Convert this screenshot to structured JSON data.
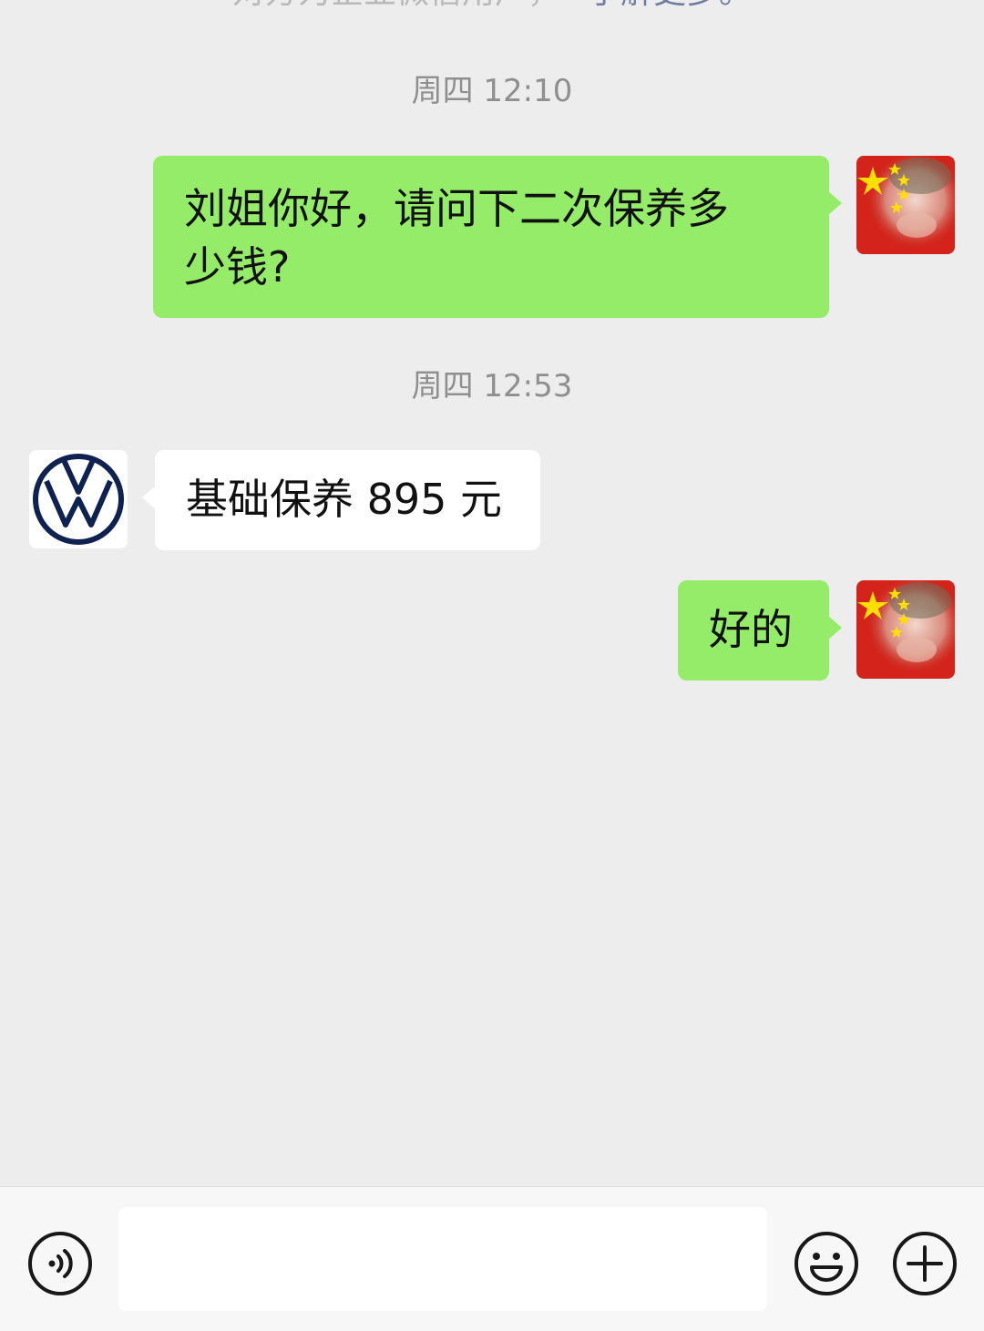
{
  "notice": {
    "text": "对方为企业微信用户，",
    "link": "了解更多。"
  },
  "messages": [
    {
      "timestamp": "周四 12:10",
      "direction": "outgoing",
      "sender_avatar": "user-avatar",
      "text_line1": "刘姐你好，请问下二次保养多",
      "text_line2": "少钱?"
    },
    {
      "timestamp": "周四 12:53",
      "direction": "incoming",
      "sender_avatar": "vw-logo-avatar",
      "text": "基础保养 895 元"
    },
    {
      "direction": "outgoing",
      "sender_avatar": "user-avatar",
      "text": "好的"
    }
  ],
  "input_bar": {
    "voice_icon": "voice-icon",
    "emoji_icon": "emoji-icon",
    "plus_icon": "plus-icon",
    "input_value": ""
  },
  "colors": {
    "background": "#ededed",
    "outgoing_bubble": "#95ec69",
    "incoming_bubble": "#ffffff",
    "vw_blue": "#0e2150"
  }
}
